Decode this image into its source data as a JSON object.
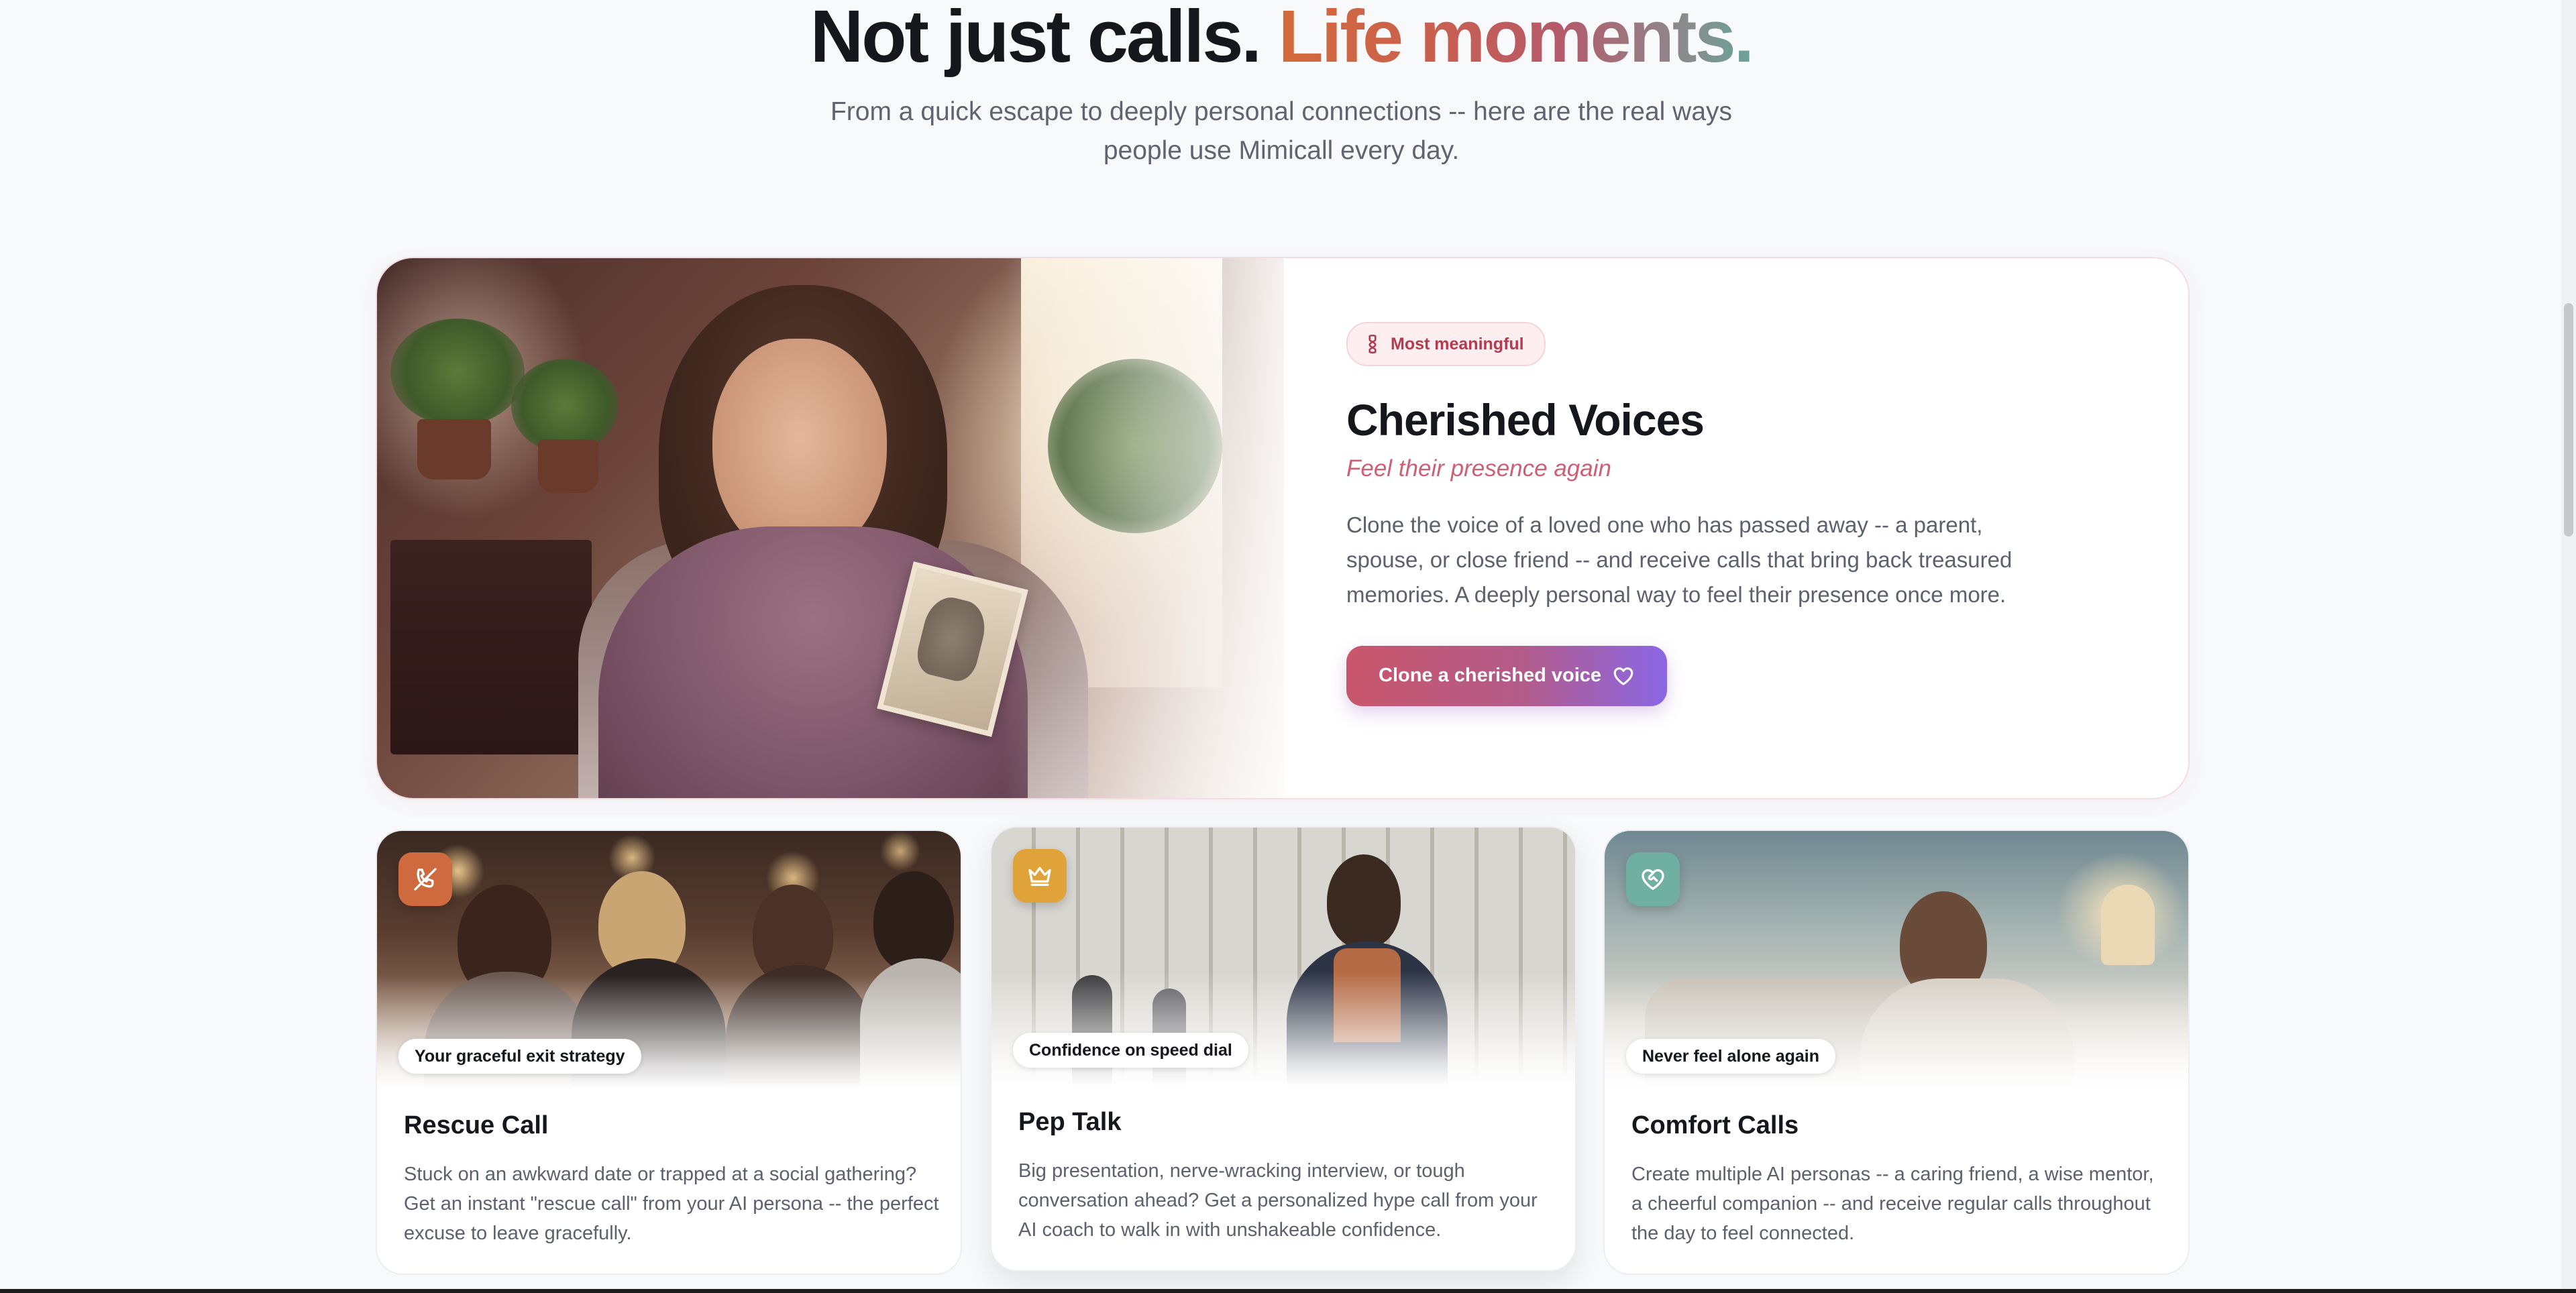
{
  "header": {
    "title_plain": "Not just calls.",
    "title_accent": "Life moments.",
    "subtitle": "From a quick escape to deeply personal connections -- here are the real ways people use Mimicall every day."
  },
  "featured": {
    "badge": "Most meaningful",
    "badge_icon": "ribbon-icon",
    "title": "Cherished Voices",
    "tagline": "Feel their presence again",
    "description": "Clone the voice of a loved one who has passed away -- a parent, spouse, or close friend -- and receive calls that bring back treasured memories. A deeply personal way to feel their presence once more.",
    "cta_label": "Clone a cherished voice",
    "cta_icon": "heart-icon",
    "colors": {
      "accent": "#cf5f74",
      "cta_start": "#c9566b",
      "cta_end": "#8a67e5"
    }
  },
  "cards": [
    {
      "icon": "phone-off-icon",
      "icon_color": "#cf6a3e",
      "chip": "Your graceful exit strategy",
      "title": "Rescue Call",
      "description": "Stuck on an awkward date or trapped at a social gathering? Get an instant \"rescue call\" from your AI persona -- the perfect excuse to leave gracefully."
    },
    {
      "icon": "crown-icon",
      "icon_color": "#e0a33a",
      "chip": "Confidence on speed dial",
      "title": "Pep Talk",
      "description": "Big presentation, nerve-wracking interview, or tough conversation ahead? Get a personalized hype call from your AI coach to walk in with unshakeable confidence."
    },
    {
      "icon": "heart-handshake-icon",
      "icon_color": "#6fb0a2",
      "chip": "Never feel alone again",
      "title": "Comfort Calls",
      "description": "Create multiple AI personas -- a caring friend, a wise mentor, a cheerful companion -- and receive regular calls throughout the day to feel connected."
    }
  ]
}
